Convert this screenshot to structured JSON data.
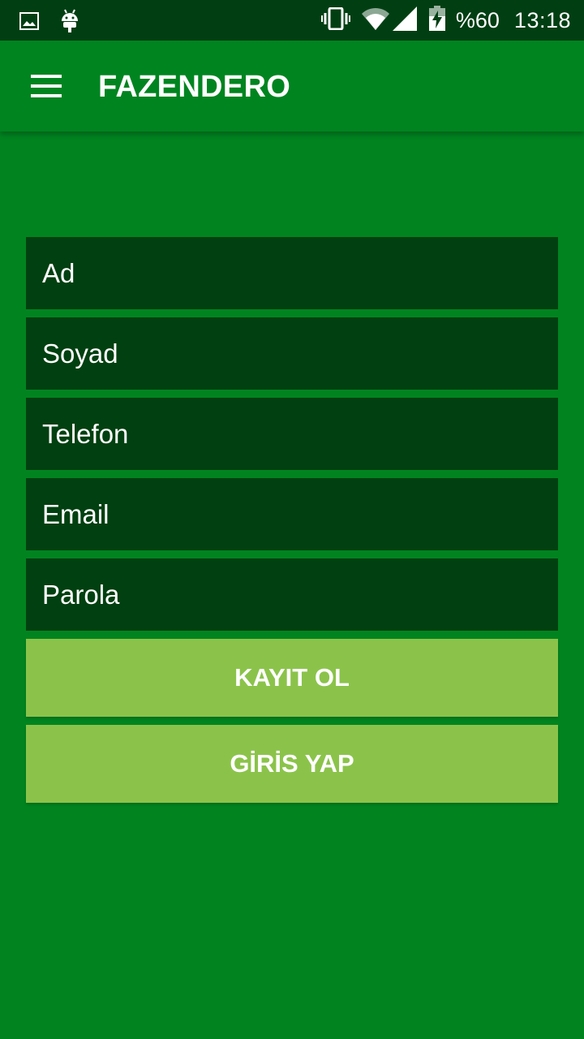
{
  "status_bar": {
    "icons_left": [
      "image-icon",
      "android-icon"
    ],
    "icons_right": [
      "vibrate-icon",
      "wifi-icon",
      "signal-icon",
      "battery-charging-icon"
    ],
    "battery": "%60",
    "time": "13:18"
  },
  "app_bar": {
    "title": "FAZENDERO",
    "menu_icon": "hamburger-menu-icon"
  },
  "form": {
    "fields": {
      "ad": {
        "placeholder": "Ad",
        "value": ""
      },
      "soyad": {
        "placeholder": "Soyad",
        "value": ""
      },
      "telefon": {
        "placeholder": "Telefon",
        "value": ""
      },
      "email": {
        "placeholder": "Email",
        "value": ""
      },
      "parola": {
        "placeholder": "Parola",
        "value": ""
      }
    },
    "register_label": "KAYIT OL",
    "login_label": "GİRİS YAP"
  },
  "colors": {
    "status_bar": "#013f13",
    "app_bar": "#008420",
    "background": "#018420",
    "field_background": "#014010",
    "button_background": "#8bc34a",
    "text": "#ffffff"
  }
}
